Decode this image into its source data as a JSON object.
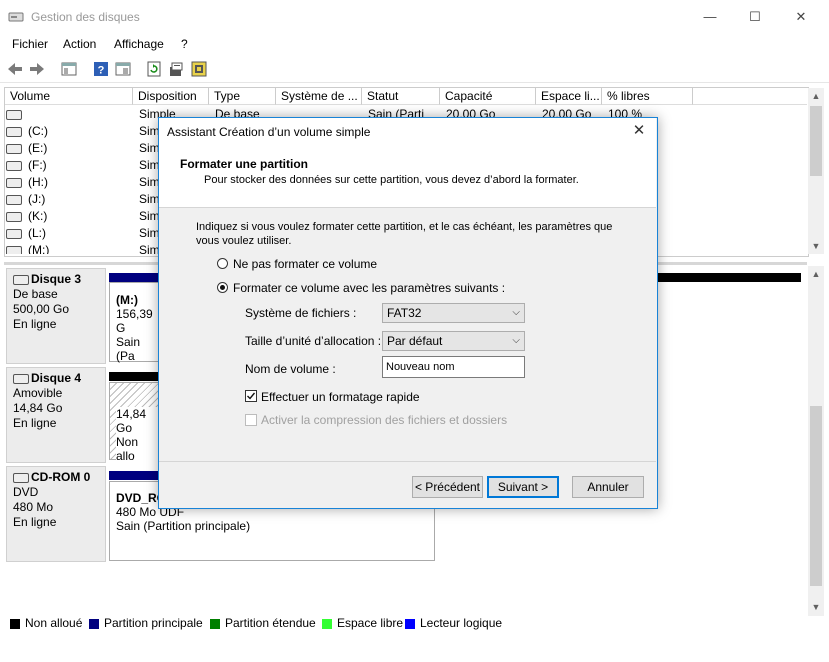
{
  "window": {
    "title": "Gestion des disques",
    "controls": {
      "minimize": "—",
      "maximize": "☐",
      "close": "✕"
    }
  },
  "menu": [
    "Fichier",
    "Action",
    "Affichage",
    "?"
  ],
  "toolbar": [
    "back-icon",
    "forward-icon",
    "show-console-icon",
    "help-icon",
    "properties-icon",
    "refresh-icon",
    "export-icon",
    "settings-icon"
  ],
  "table": {
    "columns": [
      "Volume",
      "Disposition",
      "Type",
      "Système de ...",
      "Statut",
      "Capacité",
      "Espace li...",
      "% libres"
    ],
    "rows": [
      {
        "volume": "",
        "disposition": "Simple",
        "type": "De base",
        "fs": "",
        "statut": "Sain (Parti",
        "capacite": "20,00 Go",
        "espace": "20,00 Go",
        "libres": "100 %"
      },
      {
        "volume": "(C:)",
        "disposition": "Sim"
      },
      {
        "volume": "(E:)",
        "disposition": "Sim"
      },
      {
        "volume": "(F:)",
        "disposition": "Sim"
      },
      {
        "volume": "(H:)",
        "disposition": "Sim"
      },
      {
        "volume": "(J:)",
        "disposition": "Sim"
      },
      {
        "volume": "(K:)",
        "disposition": "Sim"
      },
      {
        "volume": "(L:)",
        "disposition": "Sim"
      },
      {
        "volume": "(M:)",
        "disposition": "Sim"
      }
    ]
  },
  "disks": [
    {
      "name": "Disque 3",
      "type": "De base",
      "size": "500,00 Go",
      "state": "En ligne",
      "partition": {
        "name": "(M:)",
        "line2": "156,39 G",
        "line3": "Sain (Pa"
      }
    },
    {
      "name": "Disque 4",
      "type": "Amovible",
      "size": "14,84 Go",
      "state": "En ligne",
      "partition": {
        "name": "",
        "line2": "14,84 Go",
        "line3": "Non allo"
      }
    },
    {
      "name": "CD-ROM 0",
      "type": "DVD",
      "size": "480 Mo",
      "state": "En ligne",
      "partition": {
        "name": "DVD_RO",
        "line2": "480 Mo UDF",
        "line3": "Sain (Partition principale)"
      }
    }
  ],
  "legend": [
    {
      "label": "Non alloué",
      "color": "#000000"
    },
    {
      "label": "Partition principale",
      "color": "#00007f"
    },
    {
      "label": "Partition étendue",
      "color": "#007f00"
    },
    {
      "label": "Espace libre",
      "color": "#33ff33"
    },
    {
      "label": "Lecteur logique",
      "color": "#0000ff"
    }
  ],
  "dialog": {
    "title": "Assistant Création d’un volume simple",
    "close": "✕",
    "header_title": "Formater une partition",
    "header_subtitle": "Pour stocker des données sur cette partition, vous devez d’abord la formater.",
    "intro": "Indiquez si vous voulez formater cette partition, et le cas échéant, les paramètres que vous voulez utiliser.",
    "option_no_format": "Ne pas formater ce volume",
    "option_format": "Formater ce volume avec les paramètres suivants :",
    "fs_label": "Système de fichiers :",
    "fs_value": "FAT32",
    "alloc_label": "Taille d’unité d’allocation :",
    "alloc_value": "Par défaut",
    "volname_label": "Nom de volume :",
    "volname_value": "Nouveau nom",
    "quick_format": "Effectuer un formatage rapide",
    "compression": "Activer la compression des fichiers et dossiers",
    "btn_prev": "< Précédent",
    "btn_next": "Suivant >",
    "btn_cancel": "Annuler"
  }
}
